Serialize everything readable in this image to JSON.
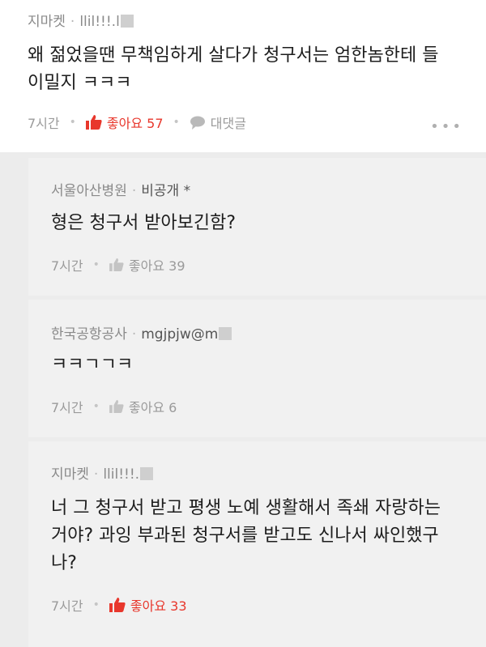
{
  "main_comment": {
    "author": "지마켓",
    "handle": "llil!!!.l",
    "text_line1": "왜 젊었을땐 무책임하게 살다가 청구서는 엄한놈한테 들",
    "text_line2": "이밀지 ㅋㅋㅋ",
    "time": "7시간",
    "like_label": "좋아요 57",
    "reply_label": "대댓글",
    "more_icon": "more-dots-icon"
  },
  "replies": [
    {
      "author": "서울아산병원",
      "handle": "비공개 *",
      "text": "형은 청구서 받아보긴함?",
      "time": "7시간",
      "like_label": "좋아요 39"
    },
    {
      "author": "한국공항공사",
      "handle": "mgjpjw@m",
      "text": "ㅋㅋㄱㄱㅋ",
      "time": "7시간",
      "like_label": "좋아요 6"
    },
    {
      "author": "지마켓",
      "handle": "llil!!!.",
      "text_line1": "너 그 청구서 받고 평생 노예 생활해서 족쇄 자랑하는",
      "text_line2": "거야? 과잉 부과된 청구서를 받고도 신나서 싸인했구",
      "text_line3": "나?",
      "time": "7시간",
      "like_label": "좋아요 33"
    }
  ],
  "colors": {
    "like_active": "#e8372c",
    "meta_gray": "#8a8a8a",
    "background": "#ececec"
  }
}
